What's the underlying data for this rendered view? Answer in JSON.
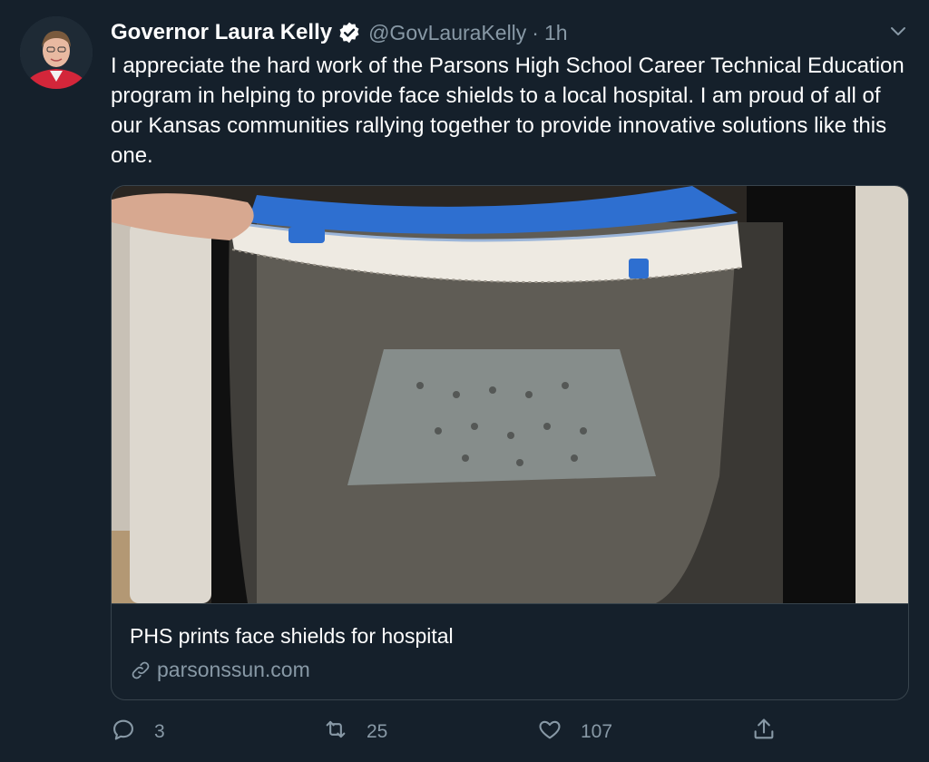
{
  "tweet": {
    "display_name": "Governor Laura Kelly",
    "handle": "@GovLauraKelly",
    "separator": "·",
    "time": "1h",
    "text": "I appreciate the hard work of the Parsons High School Career Technical Education program in helping to provide face shields to a local hospital. I am proud of all of our Kansas communities rallying together to provide innovative solutions like this one."
  },
  "card": {
    "title": "PHS prints face shields for hospital",
    "domain": "parsonssun.com"
  },
  "actions": {
    "replies": "3",
    "retweets": "25",
    "likes": "107"
  },
  "icons": {
    "verified": "verified-badge-icon",
    "caret": "chevron-down-icon",
    "link": "link-icon",
    "reply": "reply-icon",
    "retweet": "retweet-icon",
    "like": "heart-icon",
    "share": "share-icon"
  },
  "colors": {
    "background": "#15202b",
    "secondary_text": "#8899a6",
    "border": "#38444d"
  }
}
